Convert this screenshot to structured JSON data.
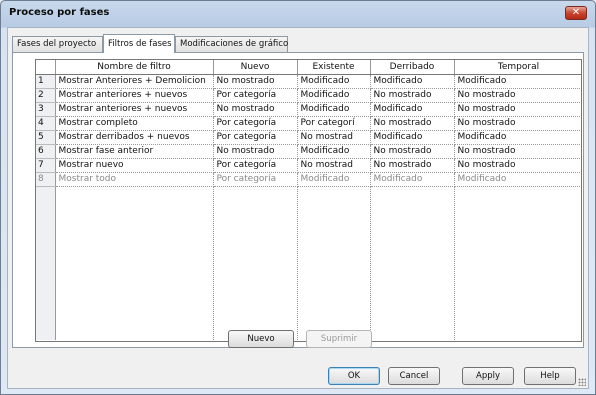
{
  "window": {
    "title": "Proceso por fases",
    "close_label": "✕"
  },
  "tabs": [
    {
      "label": "Fases del proyecto"
    },
    {
      "label": "Filtros de fases"
    },
    {
      "label": "Modificaciones de gráfico"
    }
  ],
  "table": {
    "columns": [
      "",
      "Nombre de filtro",
      "Nuevo",
      "Existente",
      "Derribado",
      "Temporal"
    ],
    "rows": [
      {
        "num": "1",
        "name": "Mostrar Anteriores + Demolicion",
        "nuevo": "No mostrado",
        "existente": "Modificado",
        "derribado": "Modificado",
        "temporal": "Modificado"
      },
      {
        "num": "2",
        "name": "Mostrar anteriores + nuevos",
        "nuevo": "Por categoría",
        "existente": "Modificado",
        "derribado": "No mostrado",
        "temporal": "No mostrado"
      },
      {
        "num": "3",
        "name": "Mostrar anteriores + nuevos",
        "nuevo": "No mostrado",
        "existente": "Modificado",
        "derribado": "Modificado",
        "temporal": "No mostrado"
      },
      {
        "num": "4",
        "name": "Mostrar completo",
        "nuevo": "Por categoría",
        "existente": "Por categorí",
        "derribado": "No mostrado",
        "temporal": "No mostrado"
      },
      {
        "num": "5",
        "name": "Mostrar derribados + nuevos",
        "nuevo": "Por categoría",
        "existente": "No mostrad",
        "derribado": "Modificado",
        "temporal": "Modificado"
      },
      {
        "num": "6",
        "name": "Mostrar fase anterior",
        "nuevo": "No mostrado",
        "existente": "Modificado",
        "derribado": "No mostrado",
        "temporal": "No mostrado"
      },
      {
        "num": "7",
        "name": "Mostrar nuevo",
        "nuevo": "Por categoría",
        "existente": "No mostrad",
        "derribado": "No mostrado",
        "temporal": "No mostrado"
      },
      {
        "num": "8",
        "name": "Mostrar todo",
        "nuevo": "Por categoría",
        "existente": "Modificado",
        "derribado": "Modificado",
        "temporal": "Modificado"
      }
    ]
  },
  "panel_buttons": {
    "new_label": "Nuevo",
    "delete_label": "Suprimir"
  },
  "footer": {
    "ok_label": "OK",
    "cancel_label": "Cancel",
    "apply_label": "Apply",
    "help_label": "Help"
  },
  "colors": {
    "accent": "#3c7fb1",
    "close": "#c8452f"
  }
}
